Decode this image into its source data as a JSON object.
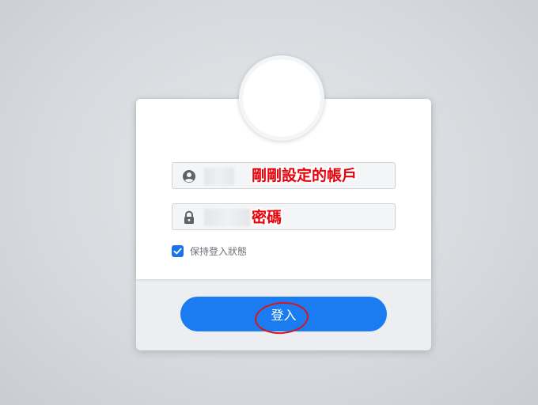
{
  "login": {
    "username": {
      "icon": "user-circle-icon",
      "value": "",
      "annotation": "剛剛設定的帳戶"
    },
    "password": {
      "icon": "lock-icon",
      "value": "",
      "annotation": "密碼"
    },
    "remember": {
      "label": "保持登入狀態",
      "checked": true
    },
    "submit_label": "登入"
  },
  "colors": {
    "accent": "#1a7cf0",
    "annotation": "#e8000b"
  }
}
